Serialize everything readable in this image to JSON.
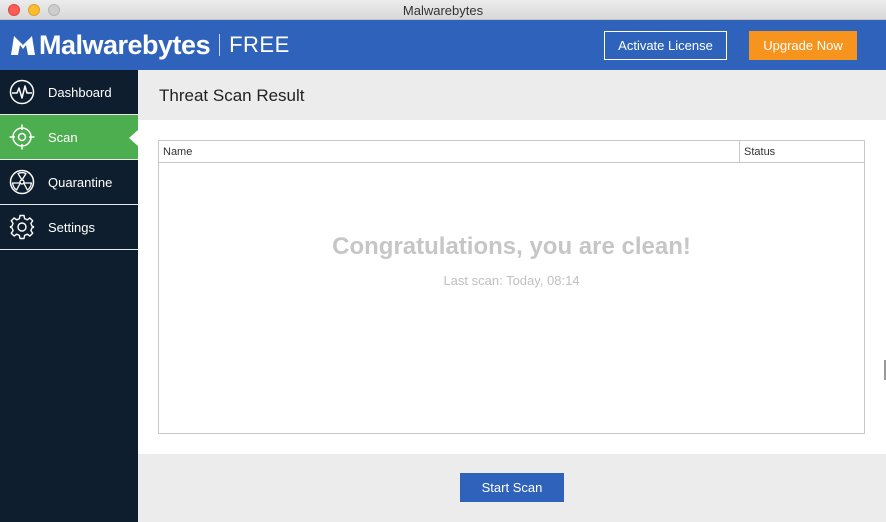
{
  "window": {
    "title": "Malwarebytes"
  },
  "brand": {
    "name": "Malwarebytes",
    "edition": "FREE"
  },
  "header": {
    "activate_label": "Activate License",
    "upgrade_label": "Upgrade Now"
  },
  "sidebar": {
    "items": [
      {
        "label": "Dashboard",
        "icon": "pulse-icon"
      },
      {
        "label": "Scan",
        "icon": "target-icon",
        "active": true
      },
      {
        "label": "Quarantine",
        "icon": "radiation-icon"
      },
      {
        "label": "Settings",
        "icon": "gear-icon"
      }
    ]
  },
  "main": {
    "title": "Threat Scan Result",
    "table": {
      "columns": [
        "Name",
        "Status"
      ],
      "rows": []
    },
    "empty_title": "Congratulations, you are clean!",
    "empty_subtitle": "Last scan: Today, 08:14",
    "start_scan_label": "Start Scan"
  },
  "colors": {
    "header": "#2f63bb",
    "sidebar": "#0f1e2e",
    "active": "#4cae4f",
    "upgrade": "#f7941d"
  }
}
